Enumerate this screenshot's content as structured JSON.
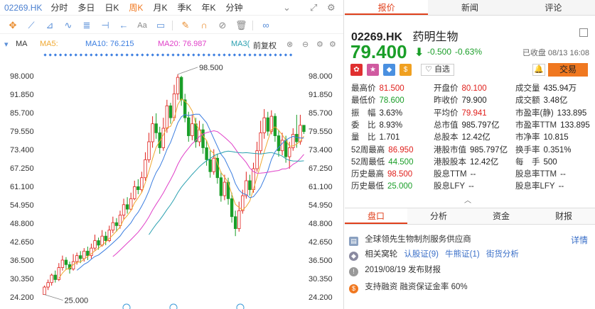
{
  "header": {
    "code": "02269.HK",
    "periods": [
      "分时",
      "多日",
      "日K",
      "周K",
      "月K",
      "季K",
      "年K",
      "分钟"
    ],
    "active_period": "周K"
  },
  "ma_legend": {
    "ma5": "MA5:",
    "ma10": "MA10: 76.215",
    "ma20": "MA20: 76.987",
    "ma30": "MA3(",
    "adjust": "前复权",
    "colors": {
      "ma5": "#f0a830",
      "ma10": "#3a7de0",
      "ma20": "#e040c8",
      "ma30": "#2aa0b0"
    }
  },
  "chart_data": {
    "type": "candlestick",
    "y_ticks": [
      "98.000",
      "91.850",
      "85.700",
      "79.550",
      "73.400",
      "67.250",
      "61.100",
      "54.950",
      "48.800",
      "42.650",
      "36.500",
      "30.350",
      "24.200"
    ],
    "ylim": [
      24.2,
      98.0
    ],
    "annotations": {
      "high": "98.500",
      "low": "25.000"
    },
    "up_color": "#e0201c",
    "down_color": "#1a9e28",
    "candles": [
      [
        25.0,
        27.5,
        25.0,
        28.0
      ],
      [
        27.5,
        29.0,
        26.5,
        30.0
      ],
      [
        29.0,
        31.5,
        28.0,
        32.0
      ],
      [
        31.5,
        30.0,
        29.0,
        33.0
      ],
      [
        30.0,
        34.0,
        29.5,
        35.5
      ],
      [
        34.0,
        36.5,
        33.0,
        38.0
      ],
      [
        36.5,
        35.0,
        33.5,
        37.5
      ],
      [
        35.0,
        33.5,
        32.0,
        36.0
      ],
      [
        33.5,
        36.0,
        33.0,
        38.5
      ],
      [
        36.0,
        38.0,
        35.0,
        39.0
      ],
      [
        38.0,
        37.0,
        35.5,
        39.5
      ],
      [
        37.0,
        39.5,
        36.0,
        40.5
      ],
      [
        39.5,
        38.0,
        36.5,
        41.0
      ],
      [
        38.0,
        40.5,
        37.0,
        42.0
      ],
      [
        40.5,
        43.0,
        39.5,
        45.0
      ],
      [
        43.0,
        41.5,
        40.0,
        44.0
      ],
      [
        41.5,
        44.5,
        41.0,
        46.5
      ],
      [
        44.5,
        43.0,
        41.5,
        46.0
      ],
      [
        43.0,
        46.5,
        42.5,
        48.0
      ],
      [
        46.5,
        49.0,
        45.5,
        51.0
      ],
      [
        49.0,
        48.0,
        46.0,
        50.5
      ],
      [
        48.0,
        51.5,
        47.0,
        53.0
      ],
      [
        51.5,
        55.0,
        50.0,
        57.0
      ],
      [
        55.0,
        53.5,
        52.0,
        57.5
      ],
      [
        53.5,
        57.0,
        53.0,
        59.0
      ],
      [
        57.0,
        61.0,
        56.5,
        63.0
      ],
      [
        61.0,
        60.0,
        58.5,
        63.5
      ],
      [
        60.0,
        64.0,
        59.0,
        66.0
      ],
      [
        64.0,
        70.0,
        63.0,
        72.5
      ],
      [
        70.0,
        76.0,
        69.0,
        79.0
      ],
      [
        76.0,
        82.0,
        74.0,
        84.5
      ],
      [
        82.0,
        79.0,
        77.0,
        85.5
      ],
      [
        79.0,
        74.0,
        72.0,
        81.0
      ],
      [
        74.0,
        80.5,
        73.0,
        84.0
      ],
      [
        80.5,
        88.0,
        79.0,
        90.0
      ],
      [
        88.0,
        84.0,
        82.0,
        89.0
      ],
      [
        84.0,
        92.0,
        83.0,
        95.0
      ],
      [
        92.0,
        97.5,
        90.0,
        98.5
      ],
      [
        97.5,
        90.0,
        88.0,
        98.0
      ],
      [
        90.0,
        84.0,
        82.5,
        92.0
      ],
      [
        84.0,
        78.0,
        76.0,
        86.0
      ],
      [
        78.0,
        82.0,
        76.5,
        85.0
      ],
      [
        82.0,
        76.0,
        74.0,
        84.0
      ],
      [
        76.0,
        80.0,
        74.5,
        83.0
      ],
      [
        80.0,
        74.0,
        72.0,
        82.0
      ],
      [
        74.0,
        70.0,
        68.0,
        76.5
      ],
      [
        70.0,
        66.0,
        64.0,
        73.0
      ],
      [
        66.0,
        70.5,
        65.0,
        73.5
      ],
      [
        70.5,
        64.0,
        62.0,
        72.0
      ],
      [
        64.0,
        58.0,
        56.0,
        66.0
      ],
      [
        58.0,
        62.5,
        56.5,
        65.0
      ],
      [
        62.5,
        57.0,
        55.0,
        64.0
      ],
      [
        57.0,
        51.0,
        49.0,
        59.0
      ],
      [
        51.0,
        47.0,
        44.5,
        53.0
      ],
      [
        47.0,
        53.0,
        46.0,
        56.0
      ],
      [
        53.0,
        58.0,
        52.0,
        60.0
      ],
      [
        58.0,
        63.0,
        57.0,
        66.0
      ],
      [
        63.0,
        60.0,
        58.0,
        65.0
      ],
      [
        60.0,
        67.0,
        59.0,
        69.0
      ],
      [
        67.0,
        73.0,
        66.0,
        76.0
      ],
      [
        73.0,
        79.0,
        72.0,
        83.0
      ],
      [
        79.0,
        84.0,
        77.0,
        86.9
      ],
      [
        84.0,
        79.5,
        78.0,
        86.0
      ],
      [
        79.5,
        84.5,
        78.5,
        86.5
      ],
      [
        84.5,
        78.0,
        76.0,
        85.5
      ],
      [
        78.0,
        73.0,
        71.0,
        80.0
      ],
      [
        73.0,
        76.5,
        71.5,
        79.0
      ],
      [
        76.5,
        71.0,
        69.0,
        78.0
      ],
      [
        71.0,
        74.0,
        67.0,
        76.0
      ],
      [
        74.0,
        78.5,
        73.0,
        80.5
      ],
      [
        78.5,
        76.0,
        74.0,
        85.0
      ],
      [
        76.0,
        81.5,
        75.0,
        85.0
      ],
      [
        81.5,
        79.4,
        78.6,
        81.5
      ]
    ]
  },
  "quote": {
    "tabs": [
      "报价",
      "新闻",
      "评论"
    ],
    "active_tab": "报价",
    "code": "02269.HK",
    "name": "药明生物",
    "price": "79.400",
    "change": "-0.500",
    "change_pct": "-0.63%",
    "status": "已收盘 08/13 16:08",
    "watch_label": "自选",
    "trade_label": "交易",
    "badges": [
      {
        "glyph": "✿",
        "color": "#e03030"
      },
      {
        "glyph": "★",
        "color": "#d05aa0"
      },
      {
        "glyph": "◆",
        "color": "#4a90e0"
      },
      {
        "glyph": "$",
        "color": "#f0a020"
      }
    ]
  },
  "stats": {
    "col1": [
      {
        "label": "最高价",
        "value": "81.500",
        "color": "red"
      },
      {
        "label": "最低价",
        "value": "78.600",
        "color": "green"
      },
      {
        "label": "振　幅",
        "value": "3.63%",
        "color": "dark"
      },
      {
        "label": "委　比",
        "value": "8.93%",
        "color": "dark"
      },
      {
        "label": "量　比",
        "value": "1.701",
        "color": "dark"
      },
      {
        "label": "52周最高",
        "value": "86.950",
        "color": "red"
      },
      {
        "label": "52周最低",
        "value": "44.500",
        "color": "green"
      },
      {
        "label": "历史最高",
        "value": "98.500",
        "color": "red"
      },
      {
        "label": "历史最低",
        "value": "25.000",
        "color": "green"
      }
    ],
    "col2": [
      {
        "label": "开盘价",
        "value": "80.100",
        "color": "red"
      },
      {
        "label": "昨收价",
        "value": "79.900",
        "color": "dark"
      },
      {
        "label": "平均价",
        "value": "79.941",
        "color": "red"
      },
      {
        "label": "总市值",
        "value": "985.797亿",
        "color": "dark"
      },
      {
        "label": "总股本",
        "value": "12.42亿",
        "color": "dark"
      },
      {
        "label": "港股市值",
        "value": "985.797亿",
        "color": "dark"
      },
      {
        "label": "港股股本",
        "value": "12.42亿",
        "color": "dark"
      },
      {
        "label": "股息TTM",
        "value": "--",
        "color": "dark"
      },
      {
        "label": "股息LFY",
        "value": "--",
        "color": "dark"
      }
    ],
    "col3": [
      {
        "label": "成交量",
        "value": "435.94万",
        "color": "dark"
      },
      {
        "label": "成交额",
        "value": "3.48亿",
        "color": "dark"
      },
      {
        "label": "市盈率(静)",
        "value": "133.895",
        "color": "dark"
      },
      {
        "label": "市盈率TTM",
        "value": "133.895",
        "color": "dark"
      },
      {
        "label": "市净率",
        "value": "10.815",
        "color": "dark"
      },
      {
        "label": "换手率",
        "value": "0.351%",
        "color": "dark"
      },
      {
        "label": "每　手",
        "value": "500",
        "color": "dark"
      },
      {
        "label": "股息率TTM",
        "value": "--",
        "color": "dark"
      },
      {
        "label": "股息率LFY",
        "value": "--",
        "color": "dark"
      }
    ]
  },
  "bottom": {
    "tabs": [
      "盘口",
      "分析",
      "资金",
      "财报"
    ],
    "active_tab": "盘口",
    "detail_label": "详情",
    "row1": "全球领先生物制剂服务供应商",
    "row2_label": "相关窝轮",
    "row2_links": [
      "认股证(9)",
      "牛熊证(1)",
      "街货分析"
    ],
    "row3": "2019/08/19  发布财报",
    "row4": "支持融资  融资保证金率 60%"
  }
}
